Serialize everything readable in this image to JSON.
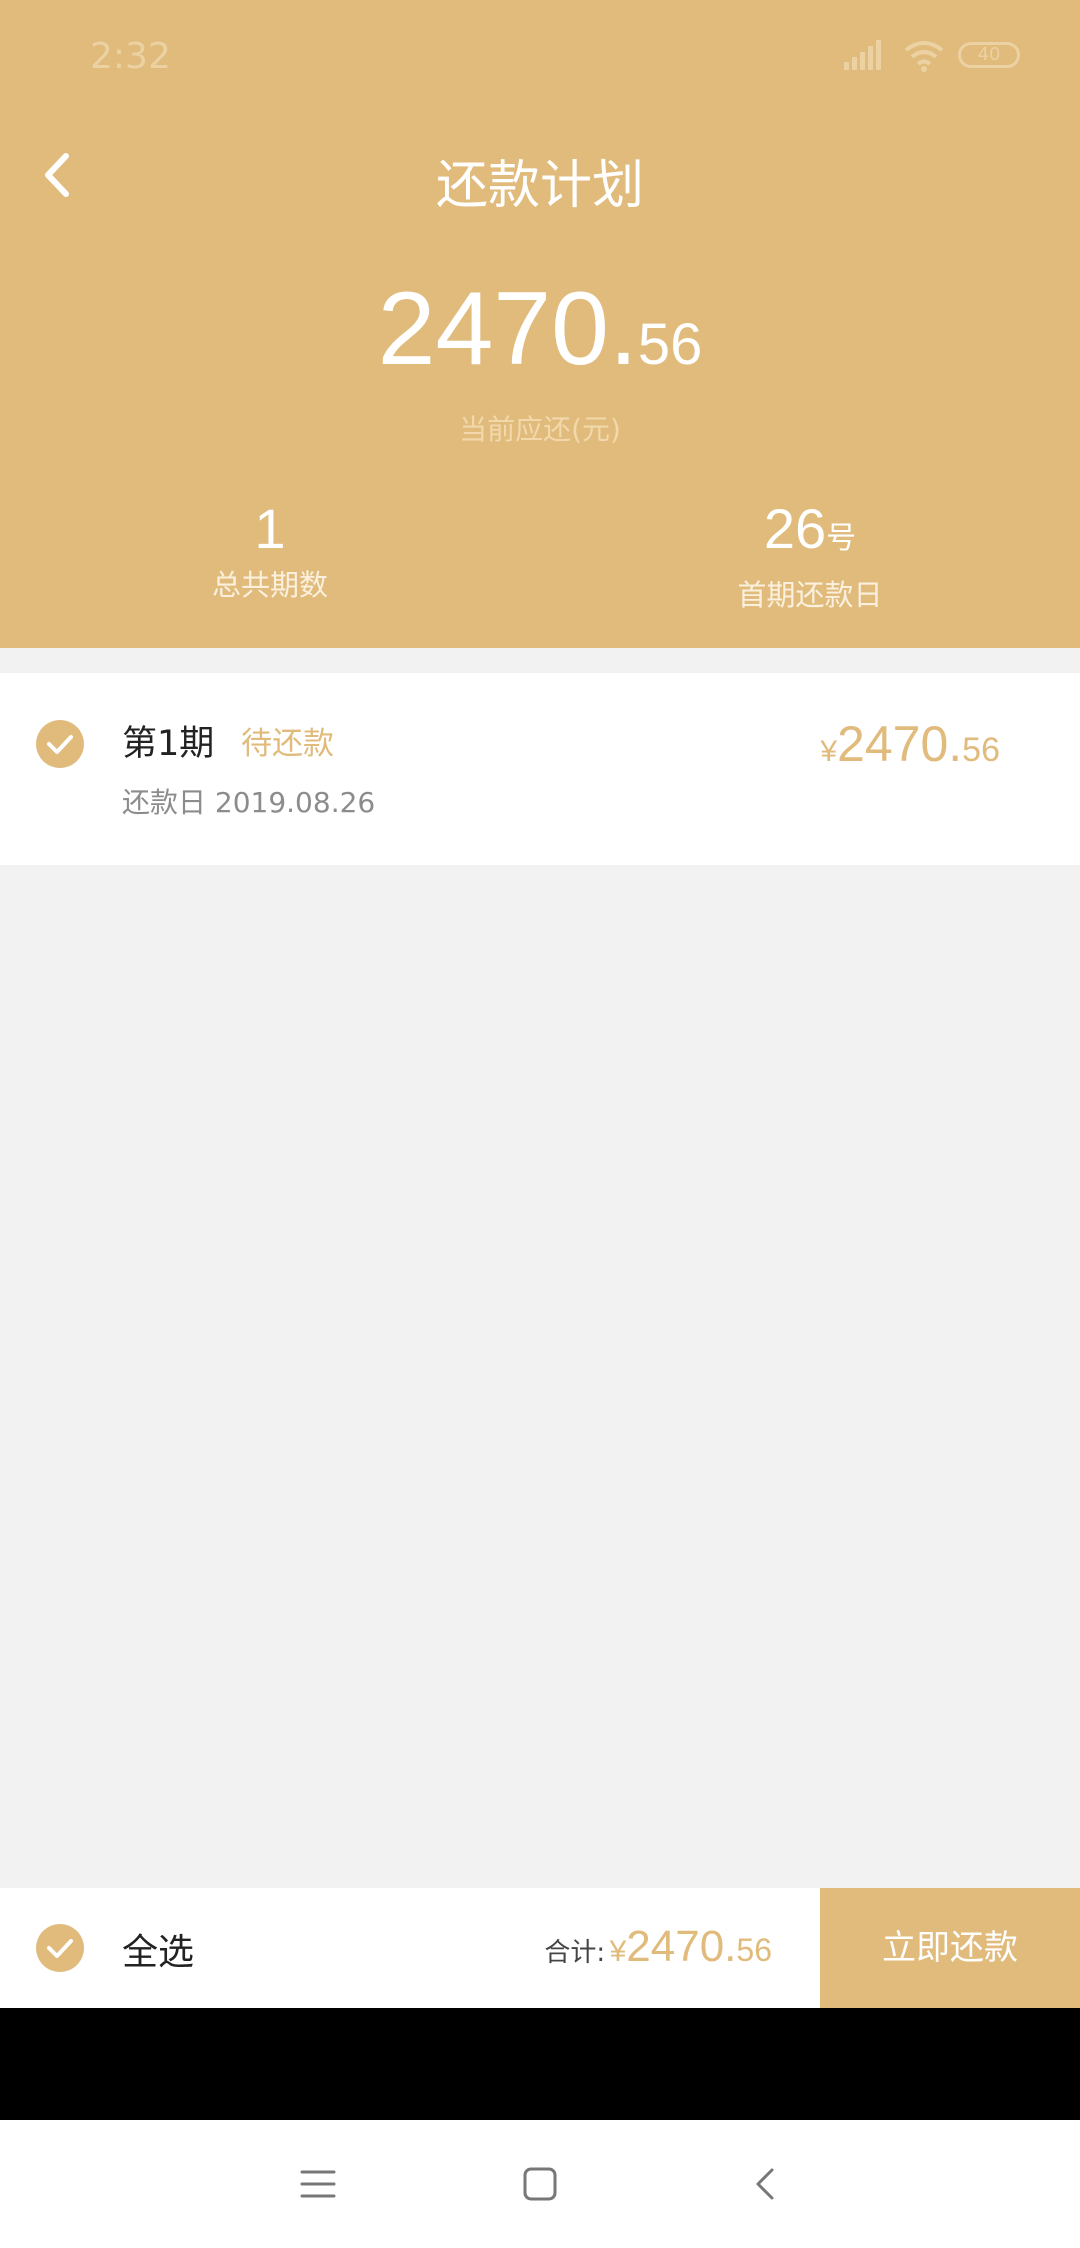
{
  "status_bar": {
    "time": "2:32",
    "battery": "40"
  },
  "header": {
    "title": "还款计划",
    "amount_int": "2470.",
    "amount_dec": "56",
    "amount_label": "当前应还(元)",
    "total_periods_value": "1",
    "total_periods_label": "总共期数",
    "first_due_day_value": "26",
    "first_due_day_unit": "号",
    "first_due_day_label": "首期还款日"
  },
  "installments": [
    {
      "period": "第1期",
      "status": "待还款",
      "due_date": "还款日 2019.08.26",
      "currency": "¥",
      "amount_int": "2470.",
      "amount_dec": "56",
      "checked": true
    }
  ],
  "footer": {
    "select_all_label": "全选",
    "total_label": "合计:",
    "currency": "¥",
    "total_int": "2470.",
    "total_dec": "56",
    "pay_button": "立即还款"
  },
  "icons": {
    "back": "chevron-left-icon",
    "check": "check-circle-icon",
    "nav_menu": "menu-icon",
    "nav_home": "square-icon",
    "nav_back": "chevron-left-icon"
  },
  "colors": {
    "accent": "#e0bb7c",
    "background": "#f2f2f2",
    "text_dark": "#222222",
    "text_muted": "#8c8c8c"
  }
}
